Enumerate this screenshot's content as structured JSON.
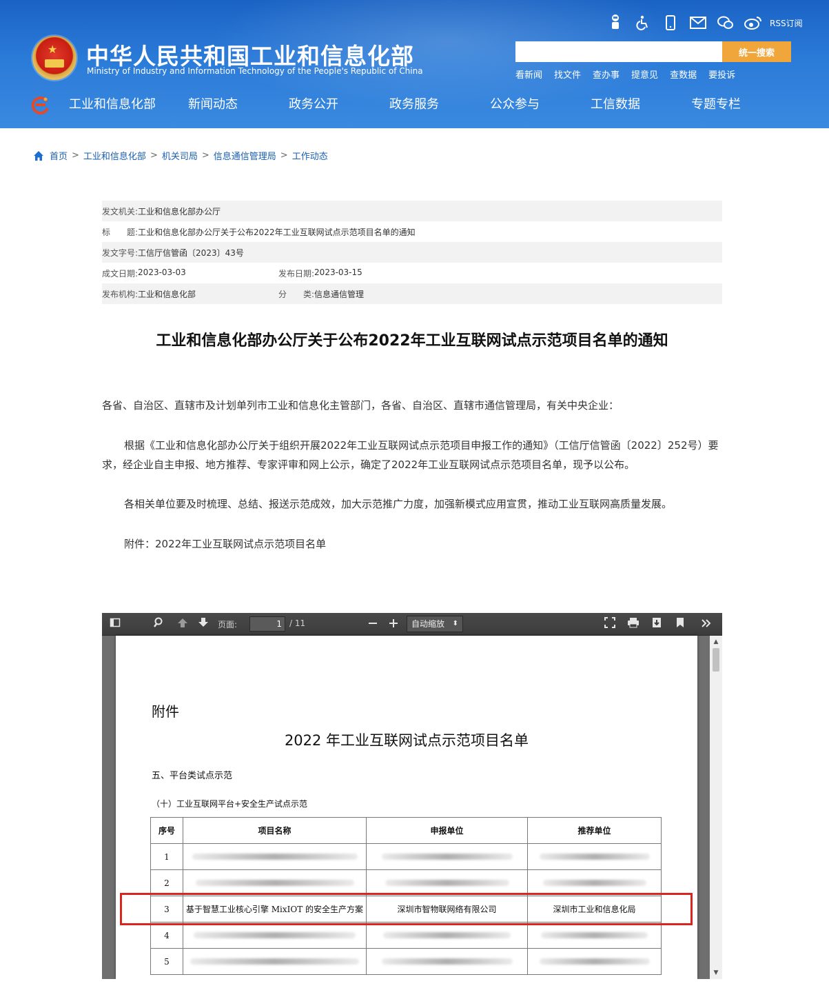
{
  "header": {
    "site_title": "中华人民共和国工业和信息化部",
    "site_subtitle": "Ministry of Industry and Information Technology of the People's Republic of China",
    "rss_label": "RSS订阅",
    "search_button": "统一搜索",
    "search_placeholder": "",
    "quick_links": [
      "看新闻",
      "找文件",
      "查办事",
      "提意见",
      "查数据",
      "要投诉"
    ],
    "nav": [
      "工业和信息化部",
      "新闻动态",
      "政务公开",
      "政务服务",
      "公众参与",
      "工信数据",
      "专题专栏"
    ],
    "icons": [
      "robot-icon",
      "accessibility-icon",
      "mobile-icon",
      "mail-icon",
      "wechat-icon",
      "weibo-icon"
    ]
  },
  "breadcrumb": {
    "items": [
      "首页",
      "工业和信息化部",
      "机关司局",
      "信息通信管理局",
      "工作动态"
    ],
    "separator": ">"
  },
  "meta": {
    "issuer_label": "发文机关:",
    "issuer": "工业和信息化部办公厅",
    "title_label": "标　　题:",
    "title": "工业和信息化部办公厅关于公布2022年工业互联网试点示范项目名单的通知",
    "docno_label": "发文字号:",
    "docno": "工信厅信管函〔2023〕43号",
    "written_label": "成文日期:",
    "written": "2023-03-03",
    "published_label": "发布日期:",
    "published": "2023-03-15",
    "org_label": "发布机构:",
    "org": "工业和信息化部",
    "category_label": "分　　类:",
    "category": "信息通信管理"
  },
  "article": {
    "title": "工业和信息化部办公厅关于公布2022年工业互联网试点示范项目名单的通知",
    "p0": "各省、自治区、直辖市及计划单列市工业和信息化主管部门，各省、自治区、直辖市通信管理局，有关中央企业：",
    "p1": "根据《工业和信息化部办公厅关于组织开展2022年工业互联网试点示范项目申报工作的通知》（工信厅信管函〔2022〕252号）要求，经企业自主申报、地方推荐、专家评审和网上公示，确定了2022年工业互联网试点示范项目名单，现予以公布。",
    "p2": "各相关单位要及时梳理、总结、报送示范成效，加大示范推广力度，加强新模式应用宣贯，推动工业互联网高质量发展。",
    "p3": "附件：2022年工业互联网试点示范项目名单"
  },
  "viewer": {
    "page_label": "页面:",
    "page_current": "1",
    "page_total": "/ 11",
    "zoom": "自动缩放",
    "pdf": {
      "attachment": "附件",
      "title": "2022 年工业互联网试点示范项目名单",
      "section": "五、平台类试点示范",
      "subsection": "（十）工业互联网平台+安全生产试点示范",
      "headers": [
        "序号",
        "项目名称",
        "申报单位",
        "推荐单位"
      ],
      "rows": [
        {
          "no": "1",
          "name": "",
          "applicant": "",
          "recommender": ""
        },
        {
          "no": "2",
          "name": "",
          "applicant": "",
          "recommender": ""
        },
        {
          "no": "3",
          "name": "基于智慧工业核心引擎 MixIOT 的安全生产方案",
          "applicant": "深圳市智物联网络有限公司",
          "recommender": "深圳市工业和信息化局"
        },
        {
          "no": "4",
          "name": "",
          "applicant": "",
          "recommender": ""
        },
        {
          "no": "5",
          "name": "",
          "applicant": "",
          "recommender": ""
        }
      ]
    }
  },
  "colors": {
    "header_blue": "#1a63c4",
    "search_orange": "#f0a63a",
    "link_blue": "#1a5fb4",
    "highlight_red": "#d9261c"
  }
}
